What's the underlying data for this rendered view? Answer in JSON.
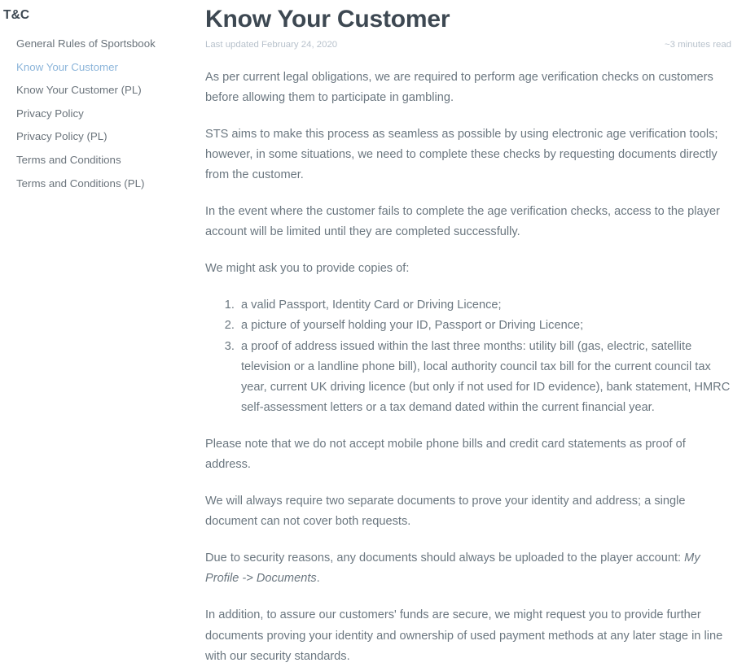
{
  "sidebar": {
    "heading": "T&C",
    "items": [
      {
        "label": "General Rules of Sportsbook",
        "active": false
      },
      {
        "label": "Know Your Customer",
        "active": true
      },
      {
        "label": "Know Your Customer (PL)",
        "active": false
      },
      {
        "label": "Privacy Policy",
        "active": false
      },
      {
        "label": "Privacy Policy (PL)",
        "active": false
      },
      {
        "label": "Terms and Conditions",
        "active": false
      },
      {
        "label": "Terms and Conditions (PL)",
        "active": false
      }
    ],
    "active_color": "#8cb5da",
    "item_color": "#6a737b"
  },
  "article": {
    "title": "Know Your Customer",
    "last_updated": "Last updated February 24, 2020",
    "read_time": "~3 minutes read",
    "title_color": "#3d4852",
    "body_color": "#6b7780",
    "meta_color": "#b8c2cc",
    "paragraphs": {
      "p1": " As per current legal obligations, we are required to perform age verification checks on customers before allowing them to participate in gambling.",
      "p2": "STS aims to make this process as seamless as possible by using electronic age verification tools; however, in some situations, we need to complete these checks by requesting documents directly from the customer.",
      "p3": "In the event where the customer fails to complete the age verification checks, access to the player account will be limited until they are completed successfully.",
      "p4": "We might ask you to provide copies of:",
      "p5": "Please note that we do not accept mobile phone bills and credit card statements as proof of address.",
      "p6": "We will always require two separate documents to prove your identity and address; a single document can not cover both requests.",
      "p7_lead": "Due to security reasons, any documents should always be uploaded to the player account: ",
      "p7_italic": "My Profile -> Documents",
      "p7_tail": ".",
      "p8": "In addition, to assure our customers' funds are secure, we might request you to provide further documents proving your identity and ownership of used payment methods at any later stage in line with our security standards."
    },
    "document_list": [
      "a valid Passport, Identity Card or Driving Licence;",
      "a picture of yourself holding your ID, Passport or Driving Licence;",
      "a proof of address issued within the last three months: utility bill (gas, electric, satellite television or a landline phone bill), local authority council tax bill for the current council tax year, current UK driving licence (but only if not used for ID evidence), bank statement, HMRC self-assessment letters or a tax demand dated within the current financial year."
    ]
  }
}
